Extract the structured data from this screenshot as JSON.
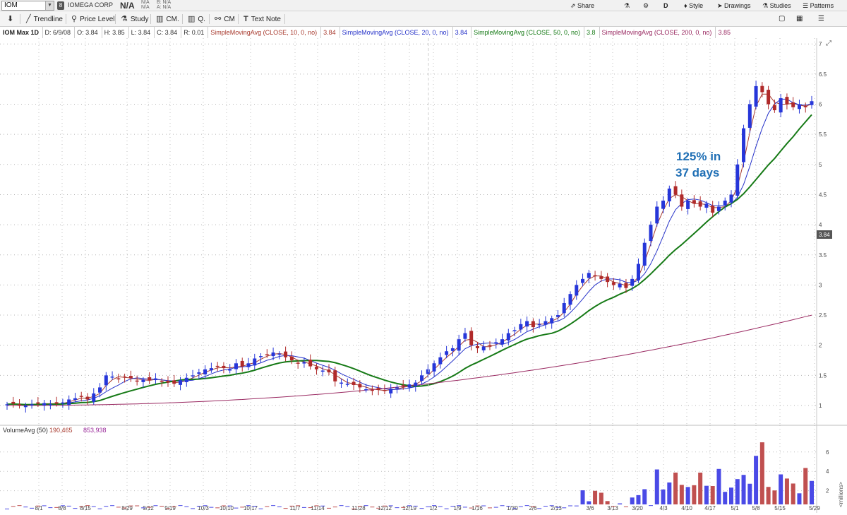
{
  "header": {
    "symbol": "IOM",
    "link_badge": "8",
    "company": "IOMEGA CORP",
    "last": "N/A",
    "na1a": "N/A",
    "na1b": "N/A",
    "na2a": "B: N/A",
    "na2b": "A: N/A"
  },
  "top_right": {
    "share": "Share",
    "d": "D",
    "style": "Style",
    "drawings": "Drawings",
    "studies": "Studies",
    "patterns": "Patterns"
  },
  "toolbar": {
    "trendline": "Trendline",
    "price_level": "Price Level",
    "study": "Study",
    "cm_dot": "CM.",
    "q": "Q.",
    "cm": "CM",
    "text_note": "Text Note"
  },
  "study_bar": {
    "title": "IOM Max 1D",
    "date": "D: 6/9/08",
    "open": "O: 3.84",
    "high": "H: 3.85",
    "low": "L: 3.84",
    "close": "C: 3.84",
    "range": "R: 0.01",
    "sma10": "SimpleMovingAvg (CLOSE, 10, 0, no)",
    "sma10_val": "3.84",
    "sma20": "SimpleMovingAvg (CLOSE, 20, 0, no)",
    "sma20_val": "3.84",
    "sma50": "SimpleMovingAvg (CLOSE, 50, 0, no)",
    "sma50_val": "3.8",
    "sma200": "SimpleMovingAvg (CLOSE, 200, 0, no)",
    "sma200_val": "3.85"
  },
  "volume_bar": {
    "label": "VolumeAvg (50)",
    "v1": "190,465",
    "v2": "853,938"
  },
  "annotation": {
    "line1": "125% in",
    "line2": "37 days"
  },
  "last_price_tag": "3.84",
  "volume_unit": "<millions>",
  "colors": {
    "up": "#2636d9",
    "down": "#b02a2a",
    "sma10": "#a83a2e",
    "sma20": "#2733c9",
    "sma50": "#167a16",
    "sma200": "#9a2a62",
    "annotation": "#1f6fb5",
    "volume_up": "#4a4ae6",
    "volume_down": "#c05050",
    "volume_neutral": "#4aa04a",
    "volume_avg": "#9a2a9a"
  },
  "chart_data": {
    "type": "candlestick",
    "price_axis": [
      1,
      1.5,
      2,
      2.5,
      3,
      3.5,
      4,
      4.5,
      5,
      5.5,
      6,
      6.5,
      7
    ],
    "volume_axis": [
      2,
      4,
      6
    ],
    "date_labels": [
      "8/1",
      "8/8",
      "8/15",
      "8/29",
      "9/12",
      "9/19",
      "10/3",
      "10/10",
      "10/17",
      "11/7",
      "11/14",
      "11/28",
      "12/12",
      "12/19",
      "1/2",
      "1/9",
      "1/16",
      "1/30",
      "2/6",
      "2/13",
      "3/6",
      "3/13",
      "3/20",
      "4/3",
      "4/10",
      "4/17",
      "5/1",
      "5/8",
      "5/15",
      "5/29"
    ],
    "closes": [
      1.02,
      1.03,
      1.01,
      1.0,
      1.02,
      1.03,
      1.04,
      1.02,
      1.03,
      1.05,
      1.1,
      1.12,
      1.15,
      1.1,
      1.2,
      1.3,
      1.5,
      1.48,
      1.45,
      1.47,
      1.45,
      1.4,
      1.43,
      1.42,
      1.45,
      1.4,
      1.38,
      1.36,
      1.42,
      1.46,
      1.5,
      1.55,
      1.6,
      1.62,
      1.65,
      1.62,
      1.6,
      1.7,
      1.65,
      1.7,
      1.78,
      1.82,
      1.85,
      1.88,
      1.86,
      1.8,
      1.75,
      1.7,
      1.72,
      1.65,
      1.6,
      1.58,
      1.55,
      1.4,
      1.38,
      1.36,
      1.34,
      1.3,
      1.27,
      1.25,
      1.26,
      1.24,
      1.28,
      1.3,
      1.32,
      1.35,
      1.38,
      1.5,
      1.6,
      1.7,
      1.8,
      1.9,
      1.95,
      2.1,
      2.2,
      2.0,
      1.95,
      1.98,
      2.0,
      2.05,
      2.1,
      2.2,
      2.25,
      2.35,
      2.4,
      2.3,
      2.35,
      2.4,
      2.45,
      2.5,
      2.7,
      2.85,
      3.0,
      3.1,
      3.2,
      3.15,
      3.1,
      3.05,
      3.0,
      3.02,
      2.95,
      3.1,
      3.35,
      3.7,
      4.0,
      4.3,
      4.4,
      4.6,
      4.5,
      4.3,
      4.4,
      4.35,
      4.3,
      4.35,
      4.2,
      4.3,
      4.4,
      4.5,
      5.0,
      5.6,
      6.0,
      6.3,
      6.2,
      6.0,
      5.9,
      6.1,
      6.0,
      5.95,
      6.0,
      5.95,
      6.05
    ]
  }
}
